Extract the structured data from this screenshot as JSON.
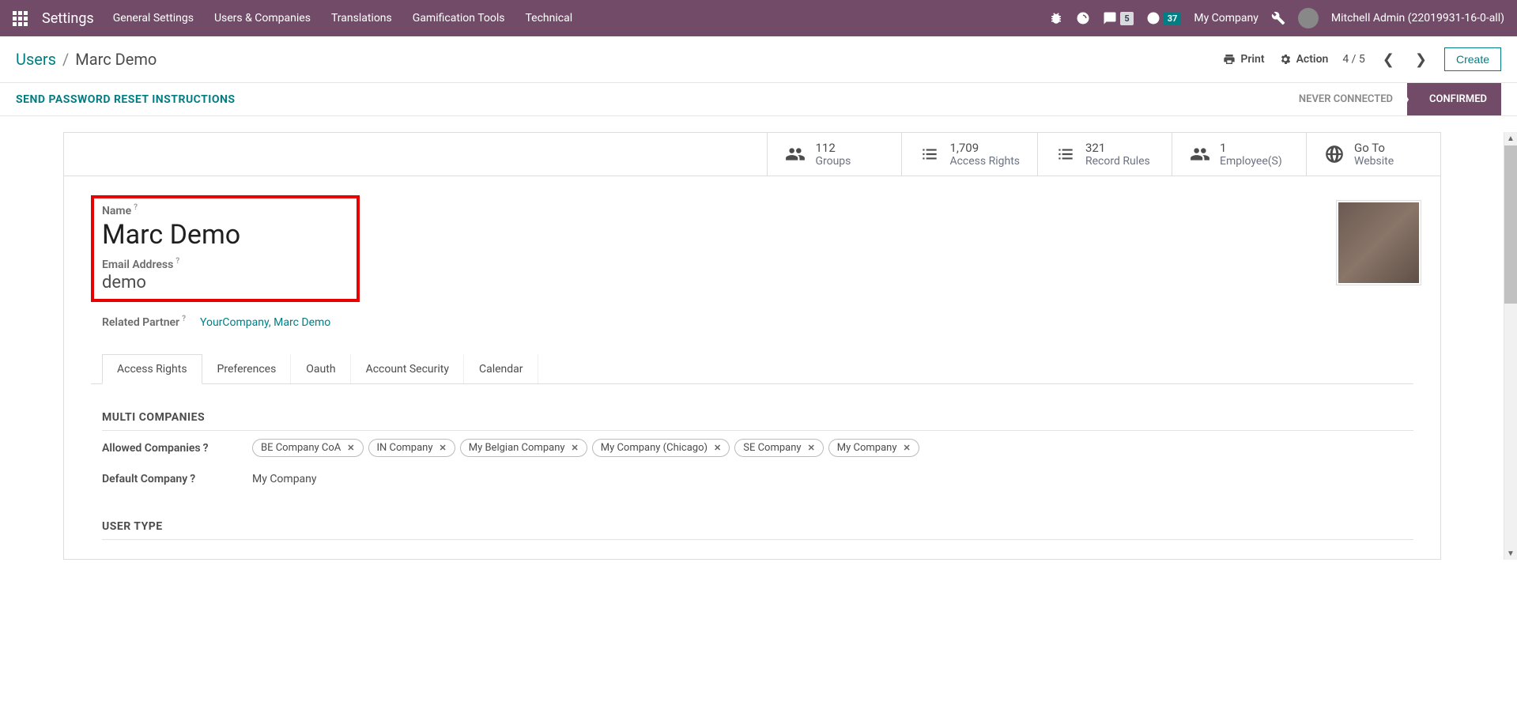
{
  "navbar": {
    "brand": "Settings",
    "menu": [
      "General Settings",
      "Users & Companies",
      "Translations",
      "Gamification Tools",
      "Technical"
    ],
    "messaging_badge": "5",
    "activity_badge": "37",
    "company": "My Company",
    "user": "Mitchell Admin (22019931-16-0-all)"
  },
  "breadcrumb": {
    "parent": "Users",
    "current": "Marc Demo",
    "print": "Print",
    "action": "Action",
    "pager": "4 / 5",
    "create": "Create"
  },
  "statusbar": {
    "reset_btn": "SEND PASSWORD RESET INSTRUCTIONS",
    "states": [
      "NEVER CONNECTED",
      "CONFIRMED"
    ]
  },
  "stat_buttons": [
    {
      "value": "112",
      "label": "Groups",
      "icon": "users"
    },
    {
      "value": "1,709",
      "label": "Access Rights",
      "icon": "list"
    },
    {
      "value": "321",
      "label": "Record Rules",
      "icon": "list"
    },
    {
      "value": "1",
      "label": "Employee(S)",
      "icon": "users"
    },
    {
      "value": "Go To",
      "label": "Website",
      "icon": "globe"
    }
  ],
  "fields": {
    "name_label": "Name",
    "name_value": "Marc Demo",
    "email_label": "Email Address",
    "email_value": "demo",
    "related_label": "Related Partner",
    "related_value": "YourCompany, Marc Demo"
  },
  "tabs": [
    "Access Rights",
    "Preferences",
    "Oauth",
    "Account Security",
    "Calendar"
  ],
  "sections": {
    "multi_companies": {
      "title": "MULTI COMPANIES",
      "allowed_label": "Allowed Companies",
      "allowed_tags": [
        "BE Company CoA",
        "IN Company",
        "My Belgian Company",
        "My Company (Chicago)",
        "SE Company",
        "My Company"
      ],
      "default_label": "Default Company",
      "default_value": "My Company"
    },
    "user_type": {
      "title": "USER TYPE"
    }
  }
}
